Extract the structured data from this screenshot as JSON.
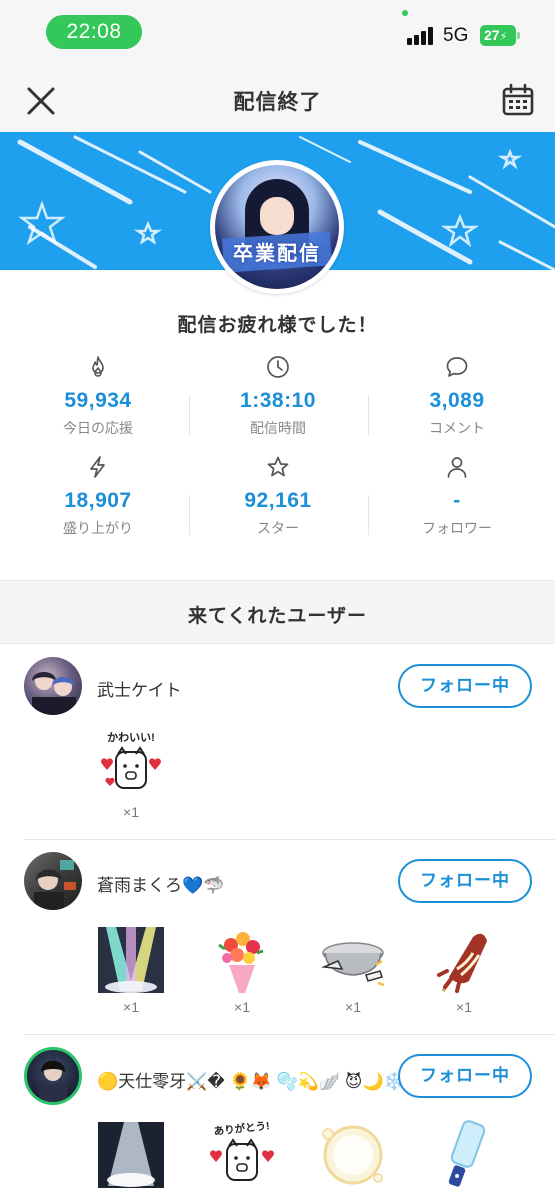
{
  "status_bar": {
    "time": "22:08",
    "network": "5G",
    "battery": "27"
  },
  "header": {
    "title": "配信終了"
  },
  "banner": {
    "avatar_text": "卒業配信"
  },
  "thanks_message": "配信お疲れ様でした！",
  "stats": [
    {
      "icon": "flame-icon",
      "value": "59,934",
      "label": "今日の応援"
    },
    {
      "icon": "clock-icon",
      "value": "1:38:10",
      "label": "配信時間"
    },
    {
      "icon": "comment-icon",
      "value": "3,089",
      "label": "コメント"
    },
    {
      "icon": "lightning-icon",
      "value": "18,907",
      "label": "盛り上がり"
    },
    {
      "icon": "star-icon",
      "value": "92,161",
      "label": "スター"
    },
    {
      "icon": "person-icon",
      "value": "-",
      "label": "フォロワー"
    }
  ],
  "section": {
    "title": "来てくれたユーザー"
  },
  "users": [
    {
      "name": "武士ケイト",
      "follow_label": "フォロー中",
      "gifts": [
        {
          "name": "kawaii-sticker-icon",
          "caption": "かわいい!",
          "count": "×1"
        }
      ]
    },
    {
      "name": "蒼雨まくろ💙🦈",
      "follow_label": "フォロー中",
      "gifts": [
        {
          "name": "spotlight-stage-icon",
          "count": "×1"
        },
        {
          "name": "bouquet-icon",
          "count": "×1"
        },
        {
          "name": "pot-icon",
          "count": "×1"
        },
        {
          "name": "squid-skewer-icon",
          "count": "×1"
        }
      ]
    },
    {
      "name": "🟡天仕零牙⚔️� 🌻🦊 🫧💫🪽 😈🌙❄️",
      "follow_label": "フォロー中",
      "gifts": [
        {
          "name": "light-beam-icon"
        },
        {
          "name": "arigatou-sticker-icon",
          "caption": "ありがとう!"
        },
        {
          "name": "bubble-icon"
        },
        {
          "name": "glowstick-icon"
        }
      ]
    }
  ],
  "colors": {
    "accent": "#1b8fd8",
    "banner": "#1ea0ef",
    "status_green": "#34c759"
  }
}
